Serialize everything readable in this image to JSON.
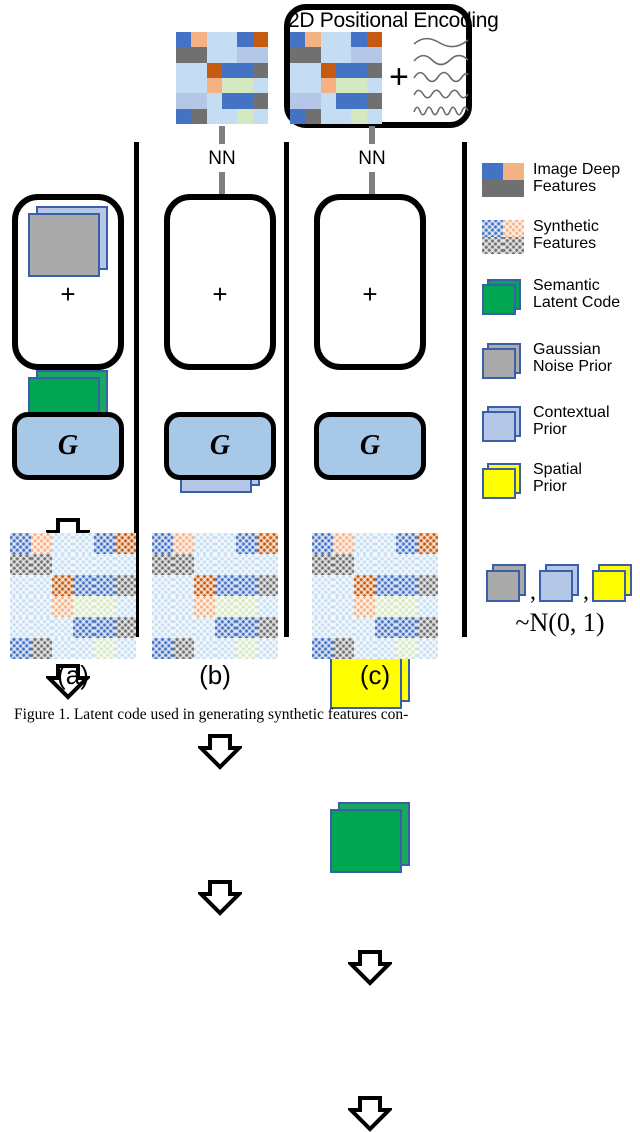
{
  "figure": {
    "caption": "Figure 1.  Latent code used in generating synthetic features con-",
    "panels": [
      {
        "id": "a",
        "label": "(a)"
      },
      {
        "id": "b",
        "label": "(b)"
      },
      {
        "id": "c",
        "label": "(c)"
      }
    ]
  },
  "positional_encoding": {
    "title": "2D Positional Encoding",
    "plus": "+",
    "wave_count": 5
  },
  "nn": {
    "label_b": "NN",
    "label_c": "NN"
  },
  "generator": {
    "label_a": "G",
    "label_b": "G",
    "label_c": "G"
  },
  "latent_sum": {
    "plus_a": "+",
    "plus_b": "+",
    "plus_c": "+"
  },
  "legend": {
    "items": [
      {
        "name": "image-deep-features",
        "label": "Image Deep\nFeatures",
        "swatch": "quad",
        "colors": [
          "#4472c4",
          "#f4b183",
          "#707070",
          "#707070"
        ]
      },
      {
        "name": "synthetic-features",
        "label": "Synthetic\nFeatures",
        "swatch": "quad-hatched",
        "colors": [
          "#4472c4",
          "#f4b183",
          "#707070",
          "#707070"
        ]
      },
      {
        "name": "semantic-latent-code",
        "label": "Semantic\nLatent Code",
        "swatch": "stack",
        "colors": [
          "#00a651"
        ]
      },
      {
        "name": "gaussian-noise-prior",
        "label": "Gaussian\nNoise Prior",
        "swatch": "stack",
        "colors": [
          "#aaaaaa"
        ]
      },
      {
        "name": "contextual-prior",
        "label": "Contextual\nPrior",
        "swatch": "stack",
        "colors": [
          "#b4c7e7"
        ]
      },
      {
        "name": "spatial-prior",
        "label": "Spatial\nPrior",
        "swatch": "stack",
        "colors": [
          "#ffff00"
        ]
      }
    ],
    "distribution": {
      "swatches": [
        "#aaaaaa",
        "#b4c7e7",
        "#ffff00"
      ],
      "separator": ",",
      "formula": "~N(0, 1)"
    }
  },
  "colors": {
    "blue_strong": "#4472c4",
    "blue_light": "#c5ddf2",
    "blue_mid": "#b4c7e7",
    "peach": "#f4b183",
    "orange_dark": "#c55a11",
    "gray": "#707070",
    "green_light": "#d6e8c0",
    "green_semantic": "#00a651",
    "yellow": "#ffff00",
    "gray_prior": "#aaaaaa",
    "generator_fill": "#a8c8e8",
    "card_border": "#3b5ea8",
    "black": "#000000",
    "arrow_gray": "#808080"
  },
  "feature_grid": {
    "rows": 6,
    "cols": 6,
    "cells": [
      [
        "blue_strong",
        "peach",
        "blue_light",
        "blue_light",
        "blue_strong",
        "orange_dark"
      ],
      [
        "gray",
        "gray",
        "blue_light",
        "blue_light",
        "blue_mid",
        "blue_mid"
      ],
      [
        "blue_light",
        "blue_light",
        "orange_dark",
        "blue_strong",
        "blue_strong",
        "gray"
      ],
      [
        "blue_light",
        "blue_light",
        "peach",
        "green_light",
        "green_light",
        "blue_light"
      ],
      [
        "blue_mid",
        "blue_mid",
        "blue_light",
        "blue_strong",
        "blue_strong",
        "gray"
      ],
      [
        "blue_strong",
        "gray",
        "blue_light",
        "blue_light",
        "green_light",
        "blue_light"
      ]
    ]
  },
  "output_grid": {
    "rows": 6,
    "cols": 6,
    "cells": [
      [
        "blue_strong",
        "peach",
        "blue_light",
        "blue_light",
        "blue_strong",
        "orange_dark"
      ],
      [
        "gray",
        "gray",
        "blue_light",
        "blue_light",
        "blue_light",
        "blue_light"
      ],
      [
        "blue_light",
        "blue_light",
        "orange_dark",
        "blue_strong",
        "blue_strong",
        "gray"
      ],
      [
        "blue_light",
        "blue_light",
        "peach",
        "green_light",
        "green_light",
        "blue_light"
      ],
      [
        "blue_light",
        "blue_light",
        "blue_light",
        "blue_strong",
        "blue_strong",
        "gray"
      ],
      [
        "blue_strong",
        "gray",
        "blue_light",
        "blue_light",
        "green_light",
        "blue_light"
      ]
    ]
  }
}
